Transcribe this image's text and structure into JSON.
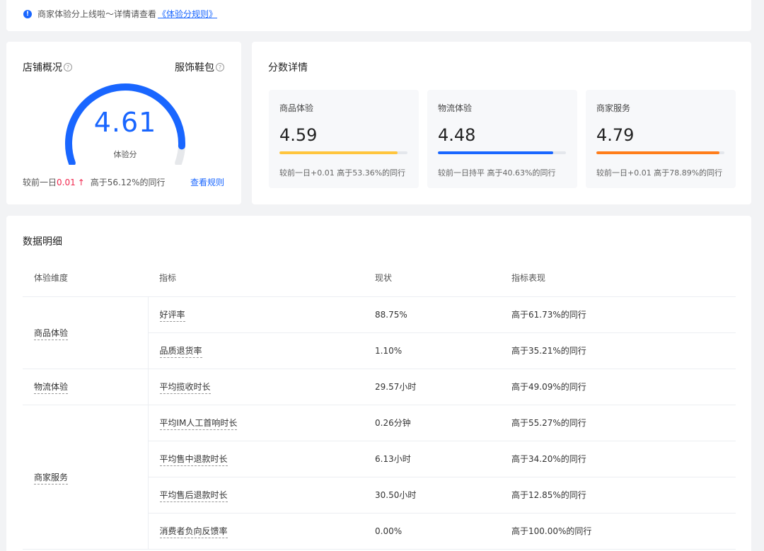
{
  "notice": {
    "text": "商家体验分上线啦～详情请查看",
    "link": "《体验分规则》"
  },
  "overview": {
    "title": "店铺概况",
    "category": "服饰鞋包",
    "score": "4.61",
    "score_label": "体验分",
    "score_fraction": 0.92,
    "compare_prefix": "较前一日",
    "compare_delta": "0.01",
    "rank_text": "高于56.12%的同行",
    "rule_link": "查看规则"
  },
  "detail": {
    "title": "分数详情",
    "cards": [
      {
        "name": "商品体验",
        "score": "4.59",
        "fraction": 0.92,
        "color": "#ffc53d",
        "foot": "较前一日+0.01 高于53.36%的同行"
      },
      {
        "name": "物流体验",
        "score": "4.48",
        "fraction": 0.9,
        "color": "#1966ff",
        "foot": "较前一日持平 高于40.63%的同行"
      },
      {
        "name": "商家服务",
        "score": "4.79",
        "fraction": 0.96,
        "color": "#ff7d1a",
        "foot": "较前一日+0.01 高于78.89%的同行"
      }
    ]
  },
  "data": {
    "title": "数据明细",
    "headers": [
      "体验维度",
      "指标",
      "现状",
      "指标表现"
    ],
    "groups": [
      {
        "dimension": "商品体验",
        "rows": [
          {
            "metric": "好评率",
            "value": "88.75%",
            "performance": "高于61.73%的同行"
          },
          {
            "metric": "品质退货率",
            "value": "1.10%",
            "performance": "高于35.21%的同行"
          }
        ]
      },
      {
        "dimension": "物流体验",
        "rows": [
          {
            "metric": "平均揽收时长",
            "value": "29.57小时",
            "performance": "高于49.09%的同行"
          }
        ]
      },
      {
        "dimension": "商家服务",
        "rows": [
          {
            "metric": "平均IM人工首响时长",
            "value": "0.26分钟",
            "performance": "高于55.27%的同行"
          },
          {
            "metric": "平均售中退款时长",
            "value": "6.13小时",
            "performance": "高于34.20%的同行"
          },
          {
            "metric": "平均售后退款时长",
            "value": "30.50小时",
            "performance": "高于12.85%的同行"
          },
          {
            "metric": "消费者负向反馈率",
            "value": "0.00%",
            "performance": "高于100.00%的同行"
          }
        ]
      }
    ]
  },
  "colors": {
    "accent": "#1966ff",
    "up": "#f0264d"
  },
  "icons": [
    "info-icon",
    "question-icon",
    "arrow-up-icon"
  ]
}
